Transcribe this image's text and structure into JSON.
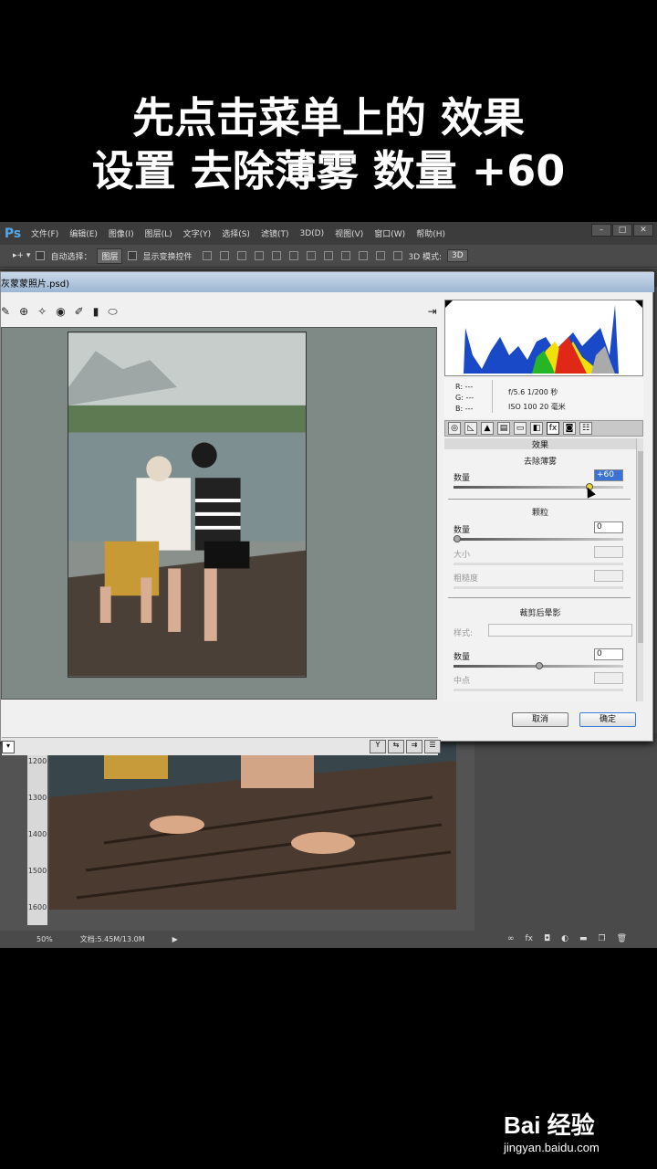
{
  "caption": {
    "line1": "先点击菜单上的 效果",
    "line2": "设置 去除薄雾 数量 +60"
  },
  "app": {
    "logo": "Ps",
    "menus": [
      "文件(F)",
      "编辑(E)",
      "图像(I)",
      "图层(L)",
      "文字(Y)",
      "选择(S)",
      "滤镜(T)",
      "3D(D)",
      "视图(V)",
      "窗口(W)",
      "帮助(H)"
    ],
    "options": {
      "auto_select": "自动选择：",
      "layer_sel": "图层",
      "show_transform": "显示变换控件",
      "mode3d_label": "3D 模式:",
      "mode3d_value": "3D"
    },
    "doc_tab": "灰蒙蒙照片.psd)",
    "status": {
      "zoom": "50%",
      "doc": "文档:5.45M/13.0M"
    },
    "ruler": [
      "1200",
      "1300",
      "1400",
      "1500",
      "1600"
    ]
  },
  "dialog": {
    "camera": {
      "r": "R:  ---",
      "g": "G:  ---",
      "b": "B:  ---",
      "exif1": "f/5.6   1/200 秒",
      "exif2": "ISO 100   20 毫米"
    },
    "panel_title": "效果",
    "dehaze": {
      "title": "去除薄雾",
      "amount_label": "数量",
      "amount_value": "+60"
    },
    "grain": {
      "title": "颗粒",
      "amount_label": "数量",
      "amount_value": "0",
      "size_label": "大小",
      "rough_label": "粗糙度"
    },
    "vignette": {
      "title": "裁剪后晕影",
      "style_label": "样式:",
      "amount_label": "数量",
      "amount_value": "0",
      "mid_label": "中点"
    },
    "cancel": "取消",
    "ok": "确定"
  },
  "watermark": {
    "brand": "Bai 经验",
    "url": "jingyan.baidu.com"
  }
}
